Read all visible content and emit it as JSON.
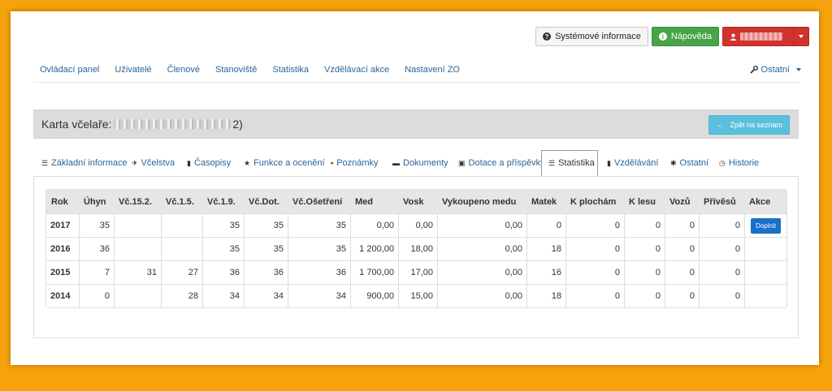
{
  "top_buttons": {
    "system_info": "Systémové informace",
    "help": "Nápověda"
  },
  "nav": {
    "items": [
      "Ovládací panel",
      "Uživatelé",
      "Členové",
      "Stanoviště",
      "Statistika",
      "Vzdělávací akce",
      "Nastavení ZO"
    ],
    "right": "Ostatní"
  },
  "header": {
    "title_prefix": "Karta včelaře:",
    "title_suffix": "2)",
    "back_button": "Zpět na seznam"
  },
  "tabs": [
    "Základní informace",
    "Včelstva",
    "Časopisy",
    "Funkce a ocenění",
    "Poznámky",
    "Dokumenty",
    "Dotace a příspěvky",
    "Statistika",
    "Vzdělávání",
    "Ostatní",
    "Historie"
  ],
  "active_tab": "Statistika",
  "table": {
    "columns": [
      "Rok",
      "Úhyn",
      "Vč.15.2.",
      "Vč.1.5.",
      "Vč.1.9.",
      "Vč.Dot.",
      "Vč.Ošetření",
      "Med",
      "Vosk",
      "Vykoupeno medu",
      "Matek",
      "K plochám",
      "K lesu",
      "Vozů",
      "Přívěsů",
      "Akce"
    ],
    "rows": [
      [
        "2017",
        "35",
        "",
        "",
        "35",
        "35",
        "35",
        "0,00",
        "0,00",
        "0,00",
        "0",
        "0",
        "0",
        "0",
        "0",
        "Doplnit"
      ],
      [
        "2016",
        "36",
        "",
        "",
        "35",
        "35",
        "35",
        "1 200,00",
        "18,00",
        "0,00",
        "18",
        "0",
        "0",
        "0",
        "0",
        ""
      ],
      [
        "2015",
        "7",
        "31",
        "27",
        "36",
        "36",
        "36",
        "1 700,00",
        "17,00",
        "0,00",
        "16",
        "0",
        "0",
        "0",
        "0",
        ""
      ],
      [
        "2014",
        "0",
        "",
        "28",
        "34",
        "34",
        "34",
        "900,00",
        "15,00",
        "0,00",
        "18",
        "0",
        "0",
        "0",
        "0",
        ""
      ]
    ]
  },
  "colors": {
    "background": "#f6a20c",
    "success": "#47a447",
    "danger": "#d2322d",
    "info": "#5bc0de",
    "primary": "#1a6fc9",
    "link": "#2a6496"
  }
}
